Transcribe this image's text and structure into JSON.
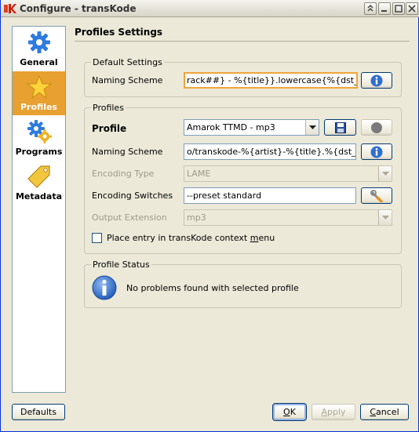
{
  "window": {
    "title": "Configure - transKode"
  },
  "sidebar": {
    "items": [
      {
        "label": "General",
        "icon": "gear-icon"
      },
      {
        "label": "Profiles",
        "icon": "star-icon",
        "selected": true
      },
      {
        "label": "Programs",
        "icon": "gears-icon"
      },
      {
        "label": "Metadata",
        "icon": "tag-icon"
      }
    ]
  },
  "page": {
    "title": "Profiles Settings"
  },
  "default_settings": {
    "title": "Default Settings",
    "naming_label": "Naming Scheme",
    "naming_value": "rack##} - %{title}}.lowercase{%{dst_ext}}"
  },
  "profiles": {
    "title": "Profiles",
    "profile_label": "Profile",
    "profile_value": "Amarok TTMD - mp3",
    "naming_label": "Naming Scheme",
    "naming_value": "o/transkode-%{artist}-%{title}.%{dst_ext}",
    "encoding_type_label": "Encoding Type",
    "encoding_type_value": "LAME",
    "switches_label": "Encoding Switches",
    "switches_value": "--preset standard",
    "ext_label": "Output Extension",
    "ext_value": "mp3",
    "context_menu_pre": "Place entry in transKode context ",
    "context_menu_u": "m",
    "context_menu_post": "enu"
  },
  "status": {
    "title": "Profile Status",
    "message": "No problems found with selected profile"
  },
  "footer": {
    "defaults": "Defaults",
    "ok_u": "O",
    "ok_rest": "K",
    "apply_u": "A",
    "apply_rest": "pply",
    "cancel_u": "C",
    "cancel_rest": "ancel"
  },
  "colors": {
    "selected": "#e8a030",
    "accent": "#f0a43a",
    "info": "#2f6fd0"
  }
}
